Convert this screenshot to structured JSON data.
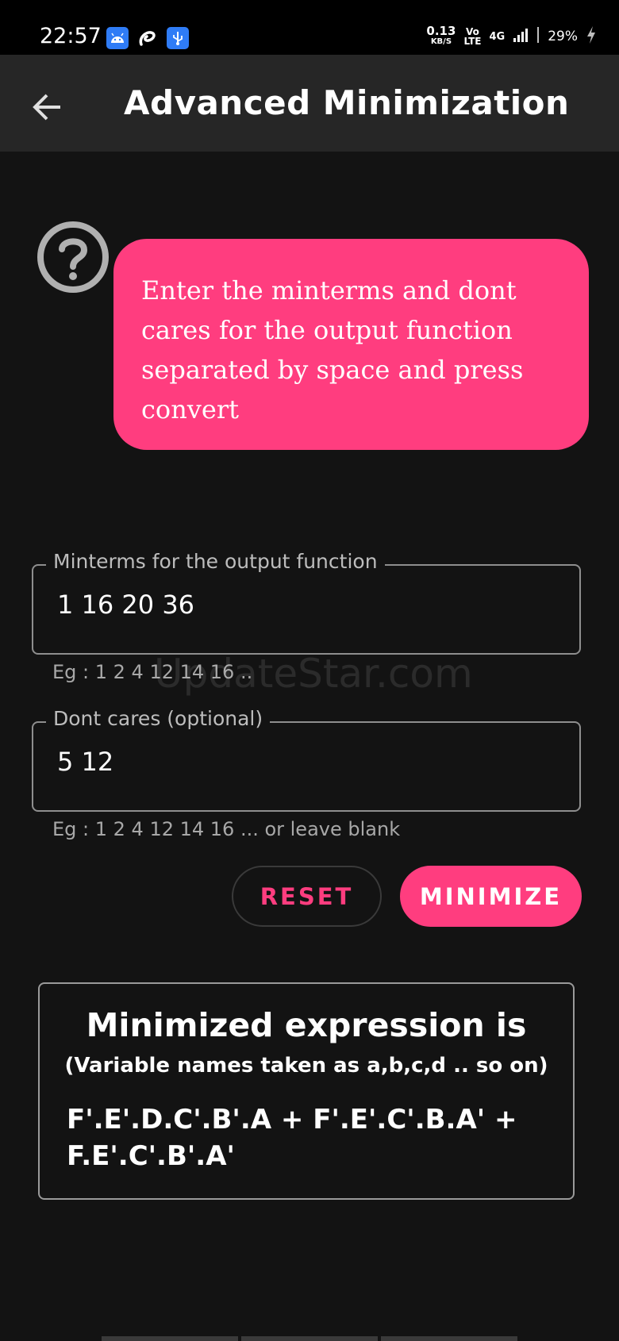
{
  "status_bar": {
    "time": "22:57",
    "net_speed_value": "0.13",
    "net_speed_unit": "KB/S",
    "volte_top": "Vo",
    "volte_bottom": "LTE",
    "network": "4G",
    "battery": "29%"
  },
  "app_bar": {
    "title": "Advanced Minimization"
  },
  "hint": {
    "text": "Enter the minterms and dont cares for the output function separated by space and press convert"
  },
  "minterms_field": {
    "label": "Minterms for the output function",
    "value": "1 16 20 36",
    "helper": "Eg : 1 2 4 12 14 16 .."
  },
  "dontcares_field": {
    "label": "Dont cares (optional)",
    "value": "5 12",
    "helper": "Eg : 1 2 4 12 14 16 ... or leave blank"
  },
  "watermark": "UpdateStar.com",
  "buttons": {
    "reset_label": "RESET",
    "minimize_label": "MINIMIZE"
  },
  "result": {
    "title": "Minimized expression is",
    "subtitle": "(Variable names taken as a,b,c,d .. so on)",
    "expression": "F'.E'.D.C'.B'.A + F'.E'.C'.B.A' + F.E'.C'.B'.A'"
  },
  "colors": {
    "accent": "#ff3d7f",
    "background": "#131313",
    "app_bar": "#262626"
  }
}
